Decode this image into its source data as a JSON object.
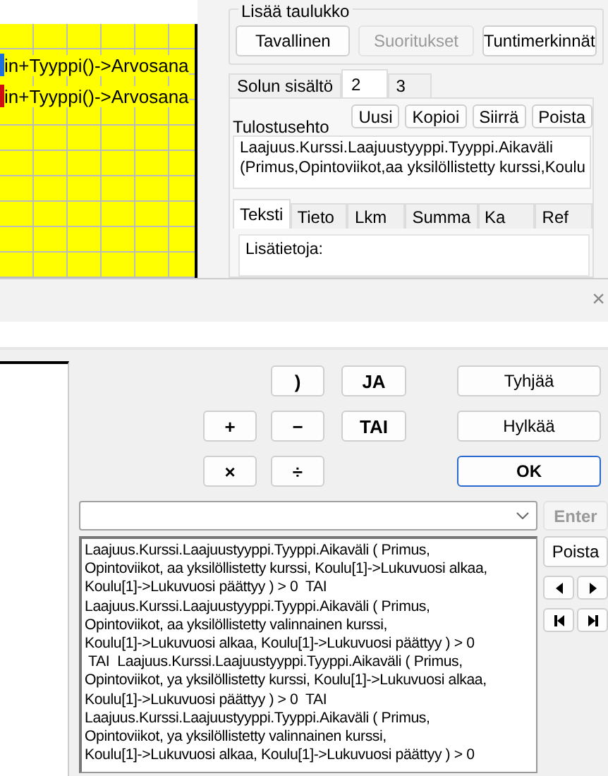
{
  "grid": {
    "rows": [
      {
        "text": "in+Tyyppi()->Arvosana",
        "color": "#1e6fd9"
      },
      {
        "text": "in+Tyyppi()->Arvosana",
        "color": "#d01010"
      }
    ]
  },
  "add_table": {
    "title": "Lisää taulukko",
    "buttons": [
      {
        "label": "Tavallinen",
        "disabled": false
      },
      {
        "label": "Suoritukset",
        "disabled": true
      },
      {
        "label": "Tuntimerkinnät",
        "disabled": false
      }
    ]
  },
  "tabs": [
    {
      "label": "Solun sisältö",
      "selected": false
    },
    {
      "label": "2",
      "selected": true
    },
    {
      "label": "3",
      "selected": false
    }
  ],
  "condition": {
    "label": "Tulostusehto",
    "buttons": [
      "Uusi",
      "Kopioi",
      "Siirrä",
      "Poista"
    ],
    "value": "Laajuus.Kurssi.Laajuustyyppi.Tyyppi.Aikaväli\n(Primus,Opintoviikot,aa yksilöllistetty kurssi,Koulu"
  },
  "inner_tabs": [
    {
      "label": "Teksti",
      "selected": true
    },
    {
      "label": "Tieto",
      "selected": false
    },
    {
      "label": "Lkm",
      "selected": false
    },
    {
      "label": "Summa",
      "selected": false
    },
    {
      "label": "Ka",
      "selected": false
    },
    {
      "label": "Ref",
      "selected": false
    }
  ],
  "info": {
    "value": "Lisätietoja:"
  },
  "dialog": {
    "close": "×",
    "operators": [
      ")",
      "JA",
      "+",
      "−",
      "TAI",
      "×",
      "÷"
    ],
    "actions": [
      {
        "label": "Tyhjää",
        "default": false
      },
      {
        "label": "Hylkää",
        "default": false
      },
      {
        "label": "OK",
        "default": true
      }
    ],
    "enter": {
      "label": "Enter",
      "disabled": true
    },
    "expression": "Laajuus.Kurssi.Laajuustyyppi.Tyyppi.Aikaväli ( Primus,\nOpintoviikot, aa yksilöllistetty kurssi, Koulu[1]->Lukuvuosi alkaa,\nKoulu[1]->Lukuvuosi päättyy ) > 0  TAI\nLaajuus.Kurssi.Laajuustyyppi.Tyyppi.Aikaväli ( Primus,\nOpintoviikot, aa yksilöllistetty valinnainen kurssi,\nKoulu[1]->Lukuvuosi alkaa, Koulu[1]->Lukuvuosi päättyy ) > 0\n TAI  Laajuus.Kurssi.Laajuustyyppi.Tyyppi.Aikaväli ( Primus,\nOpintoviikot, ya yksilöllistetty kurssi, Koulu[1]->Lukuvuosi alkaa,\nKoulu[1]->Lukuvuosi päättyy ) > 0  TAI\nLaajuus.Kurssi.Laajuustyyppi.Tyyppi.Aikaväli ( Primus,\nOpintoviikot, ya yksilöllistetty valinnainen kurssi,\nKoulu[1]->Lukuvuosi alkaa, Koulu[1]->Lukuvuosi päättyy ) > 0",
    "remove": "Poista"
  }
}
